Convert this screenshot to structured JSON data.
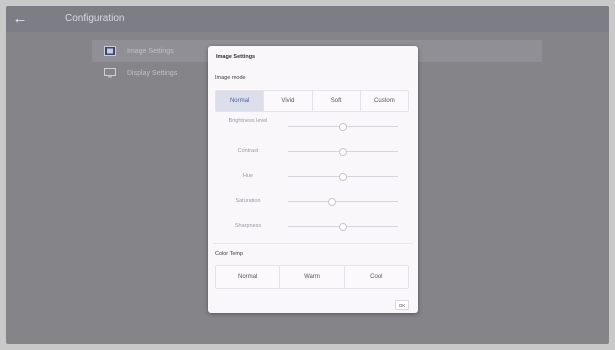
{
  "header": {
    "title": "Configuration",
    "back_icon": "arrow-left-icon"
  },
  "sidebar": {
    "items": [
      {
        "label": "Image Settings",
        "icon": "image-settings-icon",
        "selected": true
      },
      {
        "label": "Display Settings",
        "icon": "monitor-icon",
        "selected": false
      }
    ]
  },
  "dialog": {
    "title": "Image Settings",
    "image_mode": {
      "label": "Image mode",
      "options": [
        "Normal",
        "Vivid",
        "Soft",
        "Custom"
      ],
      "selected": "Normal"
    },
    "sliders": [
      {
        "label": "Brightness level",
        "value": 0.5
      },
      {
        "label": "Contrast",
        "value": 0.5
      },
      {
        "label": "Hue",
        "value": 0.5
      },
      {
        "label": "Saturation",
        "value": 0.4
      },
      {
        "label": "Sharpness",
        "value": 0.5
      }
    ],
    "color_temp": {
      "label": "Color Temp",
      "options": [
        "Normal",
        "Warm",
        "Cool"
      ]
    },
    "ok_label": "OK"
  },
  "colors": {
    "accent": "#4a5aa8",
    "selected_bg": "#dcdfe9",
    "backdrop": "#8f8f93"
  }
}
